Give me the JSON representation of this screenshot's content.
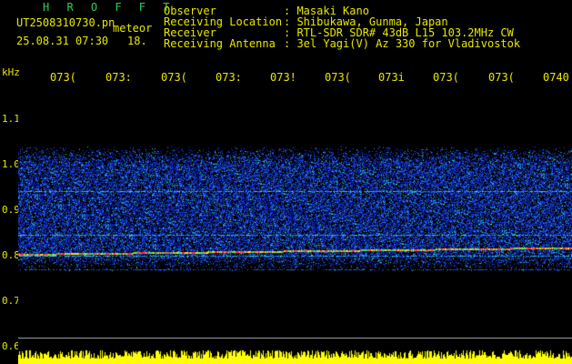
{
  "header": {
    "brand": "H R O F F T",
    "file_name": "UT2508310730.pn",
    "file_suffix": "meteor",
    "datetime": "25.08.31 07:30",
    "count": "18."
  },
  "station": [
    {
      "label": "Observer",
      "value": ": Masaki Kano"
    },
    {
      "label": "Receiving Location",
      "value": ": Shibukawa, Gunma, Japan"
    },
    {
      "label": "Receiver",
      "value": ": RTL-SDR SDR# 43dB L15 103.2MHz CW"
    },
    {
      "label": "Receiving Antenna",
      "value": ": 3el Yagi(V) Az 330 for Vladivostok"
    }
  ],
  "yaxis": {
    "unit": "kHz",
    "ticks": [
      "1.1",
      "1.0",
      "0.9",
      "0.8",
      "0.7",
      "0.6"
    ]
  },
  "xaxis": {
    "ticks": [
      "073(",
      "073:",
      "073(",
      "073:",
      "073!",
      "073(",
      "073i",
      "073(",
      "073(",
      "0740"
    ]
  },
  "colors": {
    "text": "#e8e800",
    "brand": "#2fd04a",
    "background": "#000000",
    "noise": "#1030d0",
    "band": "#ff2020",
    "level": "#ffff00"
  }
}
